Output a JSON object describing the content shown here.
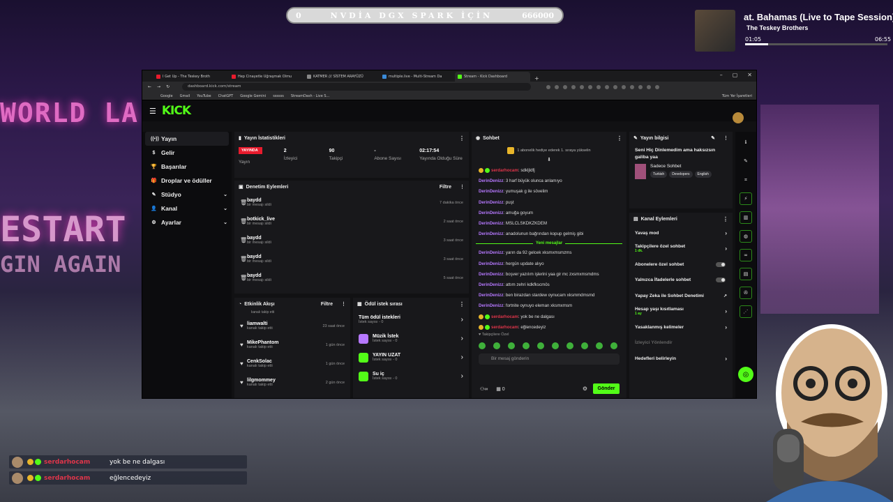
{
  "overlay": {
    "progress_start": "0",
    "progress_title": "NVDİA DGX SPARK İÇİN",
    "progress_goal": "666000",
    "progress_fraction": 0.0
  },
  "music": {
    "title": "at. Bahamas (Live to Tape Session)",
    "artist": "The Teskey Brothers",
    "elapsed": "01:05",
    "duration": "06:55",
    "progress_fraction": 0.16
  },
  "browser": {
    "tabs": [
      {
        "label": "I Get Up - The Teskey Broth",
        "color": "#e81b2d"
      },
      {
        "label": "Hep Cinayetle Uğraşmak Olmu",
        "color": "#e81b2d"
      },
      {
        "label": "KATMER /// SİSTEM ARAYÜZÜ",
        "color": "#888888"
      },
      {
        "label": "multiple.live - Multi-Stream Da",
        "color": "#3a8ad8"
      },
      {
        "label": "Stream - Kick Dashboard",
        "color": "#53fc18"
      }
    ],
    "url": "dashboard.kick.com/stream",
    "bookmarks": [
      "Google",
      "Gmail",
      "YouTube",
      "ChatGPT",
      "Google Gemini",
      "ssssss",
      "StreamDash - Live S..."
    ],
    "bookmarks_right": "Tüm Yer İşaretleri"
  },
  "kick": {
    "logo": "KICK",
    "sidebar": [
      {
        "label": "Yayın",
        "icon": "((•))",
        "expand": ""
      },
      {
        "label": "Gelir",
        "icon": "$",
        "expand": ""
      },
      {
        "label": "Başarılar",
        "icon": "🏆",
        "expand": ""
      },
      {
        "label": "Droplar ve ödüller",
        "icon": "🎁",
        "expand": ""
      },
      {
        "label": "Stüdyo",
        "icon": "✎",
        "expand": "⌄"
      },
      {
        "label": "Kanal",
        "icon": "👤",
        "expand": "⌄"
      },
      {
        "label": "Ayarlar",
        "icon": "⚙",
        "expand": "⌄"
      }
    ],
    "stats": {
      "title": "Yayın İstatistikleri",
      "live_badge": "YAYINDA",
      "items": [
        {
          "value": "",
          "label": "Yayın"
        },
        {
          "value": "2",
          "label": "İzleyici"
        },
        {
          "value": "90",
          "label": "Takipçi"
        },
        {
          "value": "-",
          "label": "Abone Sayısı"
        },
        {
          "value": "02:17:54",
          "label": "Yayında Olduğu Süre"
        }
      ]
    },
    "mod": {
      "title": "Denetim Eylemleri",
      "filter": "Filtre",
      "items": [
        {
          "name": "baydd",
          "sub": "bir mesajı sildi",
          "time": "7 dakika önce"
        },
        {
          "name": "botkick_live",
          "sub": "bir mesajı sildi",
          "time": "2 saat önce"
        },
        {
          "name": "baydd",
          "sub": "bir mesajı sildi",
          "time": "3 saat önce"
        },
        {
          "name": "baydd",
          "sub": "bir mesajı sildi",
          "time": "3 saat önce"
        },
        {
          "name": "baydd",
          "sub": "bir mesajı sildi",
          "time": "5 saat önce"
        }
      ]
    },
    "activity": {
      "title": "Etkinlik Akışı",
      "filter": "Filtre",
      "first_sub": "kanalı takip etti",
      "items": [
        {
          "name": "liamwalti",
          "sub": "kanalı takip etti",
          "time": "23 saat önce"
        },
        {
          "name": "MikePhantom",
          "sub": "kanalı takip etti",
          "time": "1 gün önce"
        },
        {
          "name": "CenkSolac",
          "sub": "kanalı takip etti",
          "time": "1 gün önce"
        },
        {
          "name": "lilgmommey",
          "sub": "kanalı takip etti",
          "time": "2 gün önce"
        }
      ]
    },
    "rewards": {
      "title": "Ödül istek sırası",
      "items": [
        {
          "name": "Tüm ödül istekleri",
          "sub": "İstek sayısı - 0"
        },
        {
          "name": "Müzik İstek",
          "sub": "İstek sayısı - 0"
        },
        {
          "name": "YAYIN UZAT",
          "sub": "İstek sayısı - 0"
        },
        {
          "name": "Su iç",
          "sub": "İstek sayısı - 0"
        }
      ]
    },
    "chat": {
      "title": "Sohbet",
      "gift_banner": "1 abonelik hediye ederek 1. sıraya yükselin",
      "lines": [
        {
          "user": "serdarhocam",
          "msg": ": sdkljldfj",
          "red": true
        },
        {
          "user": "DerinDenizz",
          "msg": ": 3 harf büyük olunca anlamıyo"
        },
        {
          "user": "DerinDenizz",
          "msg": ": yumuşak g ile sövelim"
        },
        {
          "user": "DerinDenizz",
          "msg": ": puşt"
        },
        {
          "user": "DerinDenizz",
          "msg": ": amuğa goyum"
        },
        {
          "user": "DerinDenizz",
          "msg": ": MSLCLSKDKZKDEM"
        },
        {
          "user": "DerinDenizz",
          "msg": ": anadolunun bağrından kopup gelmiş gibi"
        }
      ],
      "new_messages": "Yeni mesajlar",
      "lines2": [
        {
          "user": "DerinDenizz",
          "msg": ": yarın da 92 gelcek xksmxmsmzms"
        },
        {
          "user": "DerinDenizz",
          "msg": ": hergün update alıyo"
        },
        {
          "user": "DerinDenizz",
          "msg": ": boşver yazılım işlerini yaa gir mc zxsmxmsmdms"
        },
        {
          "user": "DerinDenizz",
          "msg": ": attım zehri kdkfkscmös"
        },
        {
          "user": "DerinDenizz",
          "msg": ": ben birazdan stardew oynucam xksmmdmsmd"
        },
        {
          "user": "DerinDenizz",
          "msg": ": fortnite oynuyo eleman xksmxmsm"
        },
        {
          "user": "serdarhocam",
          "msg": ": yok be ne dalgası",
          "red": true
        },
        {
          "user": "serdarhocam",
          "msg": ": eğlencedeyiz",
          "red": true
        }
      ],
      "followers_only": "Takipçilere Özel",
      "input_placeholder": "Bir mesaj gönderin",
      "count": "0",
      "send": "Gönder"
    },
    "info": {
      "title": "Yayın bilgisi",
      "stream_title": "Seni Hiç Dinlemedim ama haksızsın galiba yaa",
      "category": "Sadece Sohbet",
      "tags": [
        "Turkish",
        "Developers",
        "English"
      ]
    },
    "channel": {
      "title": "Kanal Eylemleri",
      "items": [
        {
          "label": "Yavaş mod",
          "sub": "",
          "ctrl": "arrow"
        },
        {
          "label": "Takipçilere özel sohbet",
          "sub": "1 dk.",
          "ctrl": "arrow"
        },
        {
          "label": "Abonelere özel sohbet",
          "sub": "",
          "ctrl": "toggle"
        },
        {
          "label": "Yalnızca İfadelerle sohbet",
          "sub": "",
          "ctrl": "toggle"
        },
        {
          "label": "Yapay Zeka ile Sohbet Denetimi",
          "sub": "",
          "ctrl": "ext"
        },
        {
          "label": "Hesap yaşı kısıtlaması",
          "sub": "1 ay",
          "ctrl": "arrow"
        },
        {
          "label": "Yasaklanmış kelimeler",
          "sub": "",
          "ctrl": "arrow"
        },
        {
          "label": "İzleyici Yönlendir",
          "sub": "",
          "ctrl": "none"
        },
        {
          "label": "Hedefleri belirleyin",
          "sub": "",
          "ctrl": "arrow"
        }
      ]
    }
  },
  "overlay_chat": [
    {
      "user": "serdarhocam",
      "msg": "yok be ne dalgası"
    },
    {
      "user": "serdarhocam",
      "msg": "eğlencedeyiz"
    }
  ],
  "bg_text": [
    "WORLD LA",
    "ESTART",
    "GIN AGAIN"
  ]
}
